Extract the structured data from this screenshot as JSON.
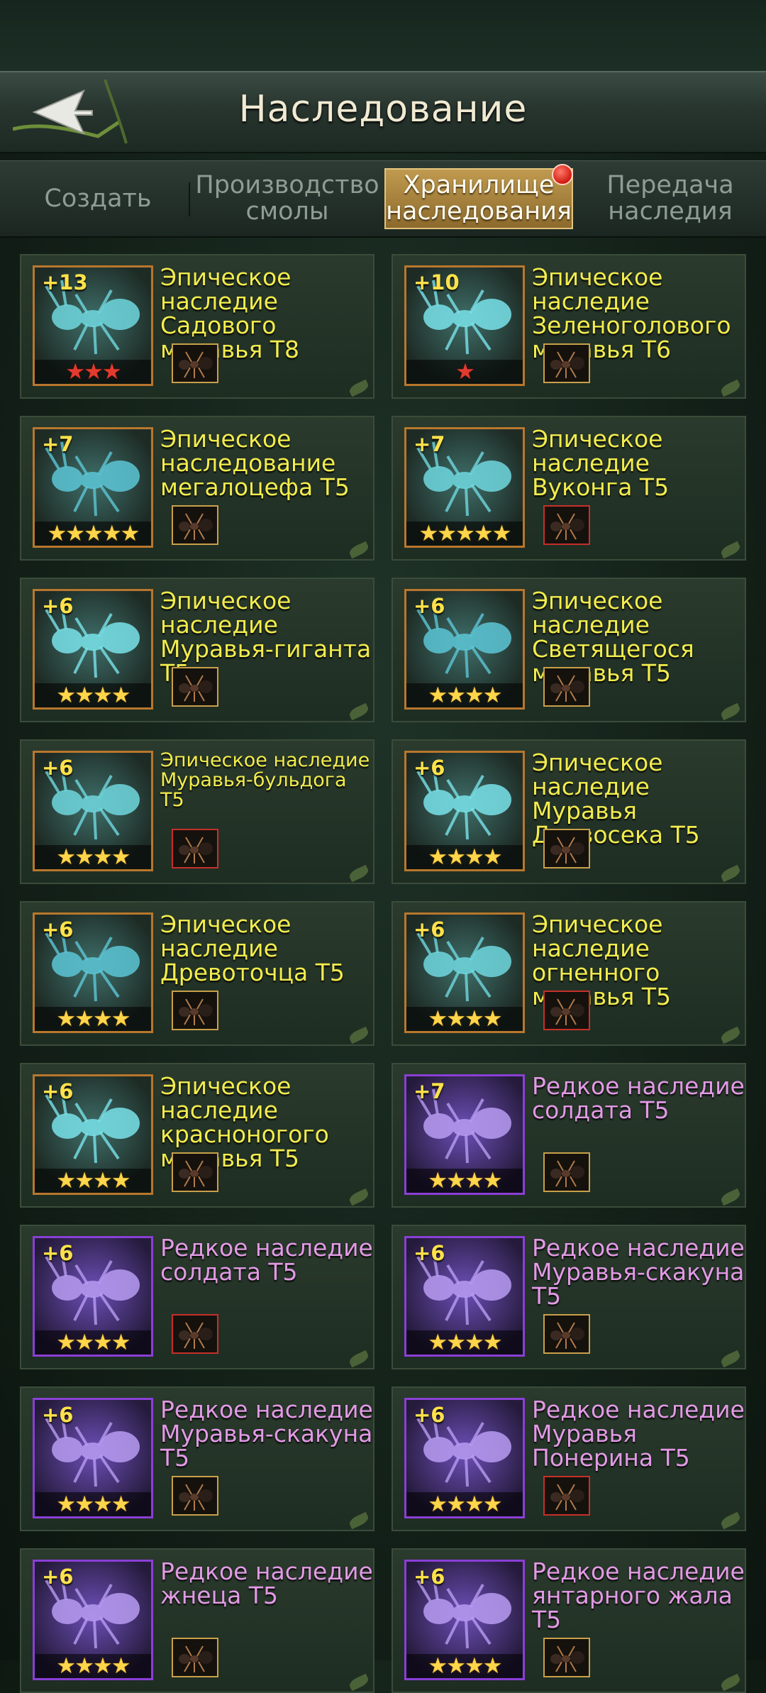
{
  "header": {
    "title": "Наследование"
  },
  "tabs": [
    {
      "label": "Создать"
    },
    {
      "label": "Производство\nсмолы"
    },
    {
      "label": "Хранилище\nнаследования"
    },
    {
      "label": "Передача\nнаследия"
    }
  ],
  "active_tab_index": 2,
  "cards": [
    {
      "level": "+13",
      "name": "Эпическое\nнаследие\nСадового\nмуравья Т8",
      "rarity": "epic",
      "stars": "★★★",
      "star_color": "red"
    },
    {
      "level": "+10",
      "name": "Эпическое\nнаследие\nЗеленоголового\nмуравья Т6",
      "rarity": "epic",
      "stars": "★",
      "star_color": "red"
    },
    {
      "level": "+7",
      "name": "Эпическое\nнаследование\nмегалоцефа Т5",
      "rarity": "epic",
      "stars": "★★★★★",
      "star_color": "gold"
    },
    {
      "level": "+7",
      "name": "Эпическое\nнаследие\nВуконга Т5",
      "rarity": "epic",
      "stars": "★★★★★",
      "star_color": "gold"
    },
    {
      "level": "+6",
      "name": "Эпическое\nнаследие\nМуравья-гиганта\nТ5",
      "rarity": "epic",
      "stars": "★★★★",
      "star_color": "gold"
    },
    {
      "level": "+6",
      "name": "Эпическое\nнаследие\nСветящегося\nмуравья Т5",
      "rarity": "epic",
      "stars": "★★★★",
      "star_color": "gold"
    },
    {
      "level": "+6",
      "name": "Эпическое наследие\nМуравья-бульдога\nТ5",
      "rarity": "epic",
      "stars": "★★★★",
      "star_color": "gold"
    },
    {
      "level": "+6",
      "name": "Эпическое\nнаследие\nМуравья\nДровосека Т5",
      "rarity": "epic",
      "stars": "★★★★",
      "star_color": "gold"
    },
    {
      "level": "+6",
      "name": "Эпическое\nнаследие\nДревоточца Т5",
      "rarity": "epic",
      "stars": "★★★★",
      "star_color": "gold"
    },
    {
      "level": "+6",
      "name": "Эпическое\nнаследие\nогненного\nмуравья Т5",
      "rarity": "epic",
      "stars": "★★★★",
      "star_color": "gold"
    },
    {
      "level": "+6",
      "name": "Эпическое\nнаследие\nкрасноногого\nмуравья Т5",
      "rarity": "epic",
      "stars": "★★★★",
      "star_color": "gold"
    },
    {
      "level": "+7",
      "name": "Редкое наследие\nсолдата Т5",
      "rarity": "rare",
      "stars": "★★★★",
      "star_color": "gold"
    },
    {
      "level": "+6",
      "name": "Редкое наследие\nсолдата Т5",
      "rarity": "rare",
      "stars": "★★★★",
      "star_color": "gold"
    },
    {
      "level": "+6",
      "name": "Редкое наследие\nМуравья-скакуна\nТ5",
      "rarity": "rare",
      "stars": "★★★★",
      "star_color": "gold"
    },
    {
      "level": "+6",
      "name": "Редкое наследие\nМуравья-скакуна\nТ5",
      "rarity": "rare",
      "stars": "★★★★",
      "star_color": "gold"
    },
    {
      "level": "+6",
      "name": "Редкое наследие\nМуравья\nПонерина Т5",
      "rarity": "rare",
      "stars": "★★★★",
      "star_color": "gold"
    },
    {
      "level": "+6",
      "name": "Редкое наследие\nжнеца Т5",
      "rarity": "rare",
      "stars": "★★★★",
      "star_color": "gold"
    },
    {
      "level": "+6",
      "name": "Редкое наследие\nянтарного жала\nТ5",
      "rarity": "rare",
      "stars": "★★★★",
      "star_color": "gold"
    }
  ],
  "colors": {
    "epic_text": "#f2ec4e",
    "rare_text": "#e29ae5",
    "active_tab": "#b08a42"
  }
}
